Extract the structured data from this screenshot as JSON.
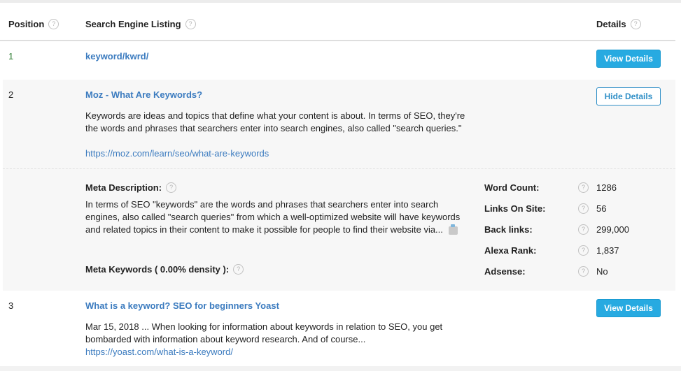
{
  "header": {
    "position_label": "Position",
    "listing_label": "Search Engine Listing",
    "details_label": "Details",
    "help_glyph": "?"
  },
  "results": [
    {
      "position": "1",
      "title": "keyword/kwrd/",
      "button": "View Details"
    },
    {
      "position": "2",
      "title": "Moz - What Are Keywords?",
      "snippet": "Keywords are ideas and topics that define what your content is about. In terms of SEO, they're the words and phrases that searchers enter into search engines, also called \"search queries.\"",
      "url": "https://moz.com/learn/seo/what-are-keywords",
      "button": "Hide Details",
      "details": {
        "meta_description_label": "Meta Description:",
        "meta_description": "In terms of SEO \"keywords\" are the words and phrases that searchers enter into search engines, also called \"search queries\" from which a well-optimized website will have keywords and related topics in their content to make it possible for people to find their website via...",
        "meta_keywords_label": "Meta Keywords ( 0.00% density ):",
        "stats": [
          {
            "label": "Word Count:",
            "value": "1286"
          },
          {
            "label": "Links On Site:",
            "value": "56"
          },
          {
            "label": "Back links:",
            "value": "299,000"
          },
          {
            "label": "Alexa Rank:",
            "value": "1,837"
          },
          {
            "label": "Adsense:",
            "value": "No"
          }
        ]
      }
    },
    {
      "position": "3",
      "title": "What is a keyword? SEO for beginners Yoast",
      "snippet": "Mar 15, 2018 ... When looking for information about keywords in relation to SEO, you get bombarded with information about keyword research. And of course...",
      "url": "https://yoast.com/what-is-a-keyword/",
      "button": "View Details"
    }
  ],
  "icons": {
    "help": "question-circle-icon",
    "puzzle": "puzzle-piece-icon"
  },
  "colors": {
    "link": "#3b7bbf",
    "button_primary": "#27aae1",
    "row_shade": "#f7f7f7"
  }
}
